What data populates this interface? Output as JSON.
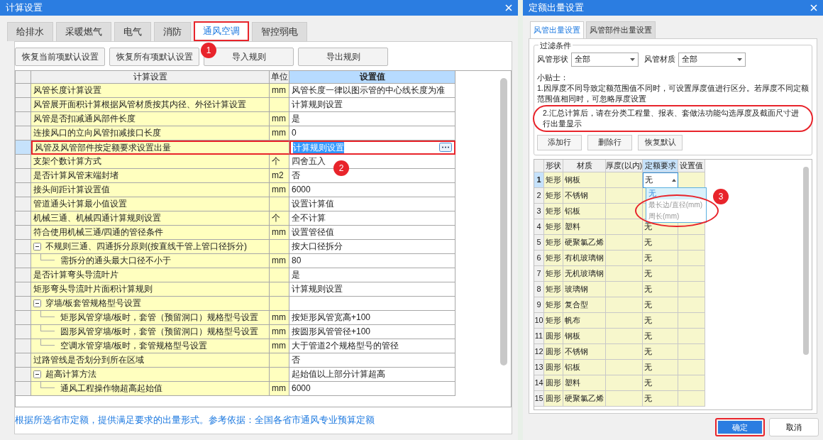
{
  "left_dialog": {
    "title": "计算设置",
    "tabs": [
      {
        "label": "给排水",
        "selected": false,
        "highlighted": false
      },
      {
        "label": "采暖燃气",
        "selected": false,
        "highlighted": false
      },
      {
        "label": "电气",
        "selected": false,
        "highlighted": false
      },
      {
        "label": "消防",
        "selected": false,
        "highlighted": false
      },
      {
        "label": "通风空调",
        "selected": true,
        "highlighted": true
      },
      {
        "label": "智控弱电",
        "selected": false,
        "highlighted": false
      }
    ],
    "buttons": [
      "恢复当前项默认设置",
      "恢复所有项默认设置",
      "导入规则",
      "导出规则"
    ],
    "table": {
      "columns": [
        "计算设置",
        "单位",
        "设置值"
      ],
      "rows": [
        {
          "name": "风管长度计算设置",
          "unit": "mm",
          "value": "风管长度一律以图示管的中心线长度为准",
          "selected": false
        },
        {
          "name": "风管展开面积计算根据风管材质按其内径、外径计算设置",
          "value": "计算规则设置",
          "selected": false
        },
        {
          "name": "风管是否扣减通风部件长度",
          "unit": "mm",
          "value": "是",
          "selected": false
        },
        {
          "name": "连接风口的立向风管扣减接口长度",
          "unit": "mm",
          "value": "0",
          "selected": false
        },
        {
          "name": "风管及风管部件按定额要求设置出量",
          "value": "计算规则设置",
          "selected": true,
          "highlighted": true
        },
        {
          "name": "支架个数计算方式",
          "unit": "个",
          "value": "四舍五入",
          "selected": false
        },
        {
          "name": "是否计算风管末端封堵",
          "unit": "m2",
          "value": "否",
          "selected": false
        },
        {
          "name": "接头间距计算设置值",
          "unit": "mm",
          "value": "6000",
          "selected": false
        },
        {
          "name": "管道通头计算最小值设置",
          "value": "设置计算值",
          "selected": false
        },
        {
          "name": "机械三通、机械四通计算规则设置",
          "unit": "个",
          "value": "全不计算",
          "selected": false
        },
        {
          "name": "符合使用机械三通/四通的管径条件",
          "unit": "mm",
          "value": "设置管径值",
          "selected": false
        },
        {
          "name": "不规则三通、四通拆分原则(按直线干管上管口径拆分)",
          "value": "按大口径拆分",
          "selected": false,
          "expanded": true,
          "children": [
            {
              "name": "需拆分的通头最大口径不小于",
              "unit": "mm",
              "value": "80",
              "selected": false
            }
          ]
        },
        {
          "name": "是否计算弯头导流叶片",
          "value": "是",
          "selected": false
        },
        {
          "name": "矩形弯头导流叶片面积计算规则",
          "value": "计算规则设置",
          "selected": false
        },
        {
          "name": "穿墙/板套管规格型号设置",
          "selected": false,
          "expanded": true,
          "children": [
            {
              "name": "矩形风管穿墙/板时，套管（预留洞口）规格型号设置",
              "unit": "mm",
              "value": "按矩形风管宽高+100",
              "selected": false
            },
            {
              "name": "圆形风管穿墙/板时，套管（预留洞口）规格型号设置",
              "unit": "mm",
              "value": "按圆形风管管径+100",
              "selected": false
            },
            {
              "name": "空调水管穿墙/板时，套管规格型号设置",
              "unit": "mm",
              "value": "大于管道2个规格型号的管径",
              "selected": false
            }
          ]
        },
        {
          "name": "过路管线是否划分到所在区域",
          "value": "否",
          "selected": false
        },
        {
          "name": "超高计算方法",
          "value": "起始值以上部分计算超高",
          "selected": false,
          "expanded": true,
          "children": [
            {
              "name": "通风工程操作物超高起始值",
              "unit": "mm",
              "value": "6000",
              "selected": false
            }
          ]
        }
      ]
    },
    "note": "根据所选省市定额，提供满足要求的出量形式。参考依据：全国各省市通风专业预算定额"
  },
  "right_dialog": {
    "title": "定额出量设置",
    "tabs": [
      {
        "label": "风管出量设置",
        "selected": true
      },
      {
        "label": "风管部件出量设置",
        "selected": false
      }
    ],
    "filter": {
      "legend": "过滤条件",
      "fields": [
        {
          "label": "风管形状",
          "value": "全部"
        },
        {
          "label": "风管材质",
          "value": "全部"
        }
      ]
    },
    "tips": [
      {
        "text": "小贴士：",
        "circled": false
      },
      {
        "text": "1.因厚度不同导致定额范围值不同时，可设置厚度值进行区分。若厚度不同定额范围值相同时，可忽略厚度设置",
        "circled": false
      },
      {
        "text": "2.汇总计算后，请在分类工程量、报表、套做法功能勾选厚度及截面尺寸进行出量显示",
        "circled": true
      }
    ],
    "buttons": [
      "添加行",
      "删除行",
      "恢复默认"
    ],
    "table": {
      "columns": [
        "形状",
        "材质",
        "厚度(以内)",
        "定额要求",
        "设置值"
      ],
      "rows": [
        {
          "index": "1",
          "shape": "矩形",
          "material": "钢板",
          "quota": "无",
          "selected": true
        },
        {
          "index": "2",
          "shape": "矩形",
          "material": "不锈钢",
          "selected": false
        },
        {
          "index": "3",
          "shape": "矩形",
          "material": "铝板",
          "selected": false
        },
        {
          "index": "4",
          "shape": "矩形",
          "material": "塑料",
          "quota": "无",
          "selected": false
        },
        {
          "index": "5",
          "shape": "矩形",
          "material": "硬聚氯乙烯",
          "quota": "无",
          "selected": false
        },
        {
          "index": "6",
          "shape": "矩形",
          "material": "有机玻璃钢",
          "quota": "无",
          "selected": false
        },
        {
          "index": "7",
          "shape": "矩形",
          "material": "无机玻璃钢",
          "quota": "无",
          "selected": false
        },
        {
          "index": "8",
          "shape": "矩形",
          "material": "玻璃钢",
          "quota": "无",
          "selected": false
        },
        {
          "index": "9",
          "shape": "矩形",
          "material": "复合型",
          "quota": "无",
          "selected": false
        },
        {
          "index": "10",
          "shape": "矩形",
          "material": "帆布",
          "quota": "无",
          "selected": false
        },
        {
          "index": "11",
          "shape": "圆形",
          "material": "钢板",
          "quota": "无",
          "selected": false
        },
        {
          "index": "12",
          "shape": "圆形",
          "material": "不锈钢",
          "quota": "无",
          "selected": false
        },
        {
          "index": "13",
          "shape": "圆形",
          "material": "铝板",
          "quota": "无",
          "selected": false
        },
        {
          "index": "14",
          "shape": "圆形",
          "material": "塑料",
          "quota": "无",
          "selected": false
        },
        {
          "index": "15",
          "shape": "圆形",
          "material": "硬聚氯乙烯",
          "quota": "无",
          "selected": false
        }
      ]
    },
    "dropdown": {
      "options": [
        {
          "label": "无",
          "selected": true,
          "circled": false
        },
        {
          "label": "最长边/直径(mm)",
          "selected": false,
          "circled": true
        },
        {
          "label": "周长(mm)",
          "selected": false,
          "circled": true
        }
      ]
    },
    "footer_buttons": [
      {
        "label": "确定",
        "kind": "primary",
        "highlighted": true
      },
      {
        "label": "取消",
        "kind": "secondary",
        "highlighted": false
      }
    ]
  },
  "callouts": [
    {
      "label": "1"
    },
    {
      "label": "2"
    },
    {
      "label": "3"
    }
  ]
}
